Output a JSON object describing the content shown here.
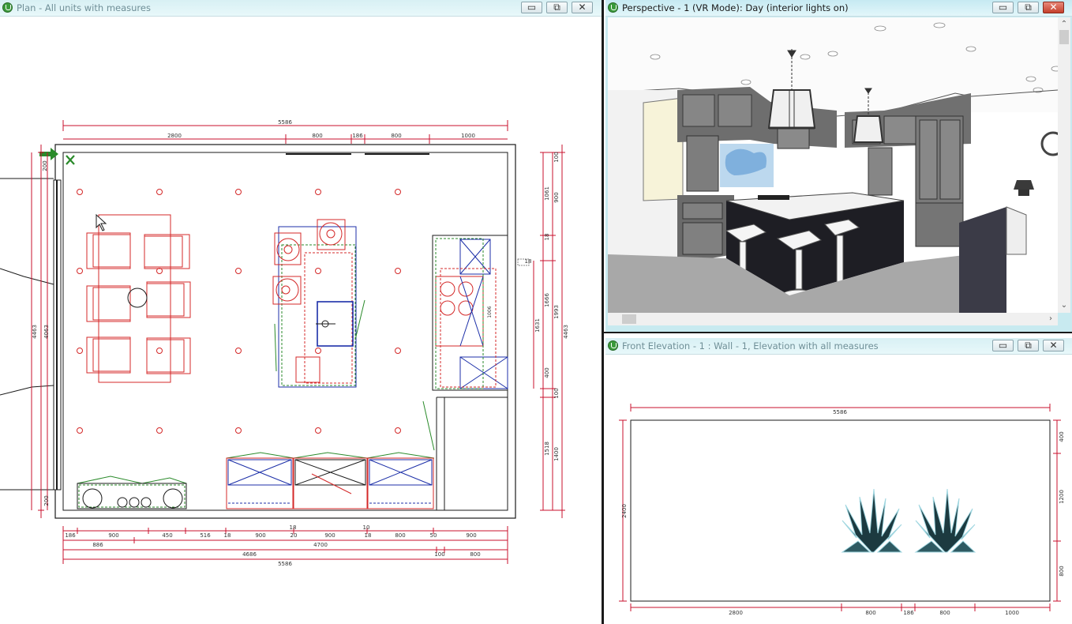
{
  "windows": {
    "plan": {
      "title": "Plan - All units with measures"
    },
    "perspective": {
      "title": "Perspective - 1 (VR Mode): Day (interior lights on)"
    },
    "elevation": {
      "title": "Front Elevation - 1 : Wall - 1, Elevation with all measures"
    }
  },
  "controls": {
    "minimize": "▭",
    "restore": "⧉",
    "close": "✕"
  },
  "plan_dims": {
    "top_total": "5586",
    "top_a": "2800",
    "top_b": "800",
    "top_c": "186",
    "top_d": "800",
    "top_e": "1000",
    "bottom_row1": [
      "186",
      "900",
      "450",
      "516",
      "18",
      "900",
      "20",
      "900",
      "18",
      "800",
      "50",
      "900"
    ],
    "bottom_extra_a": "18",
    "bottom_extra_b": "10",
    "bottom_row2_a": "886",
    "bottom_row2_b": "4700",
    "bottom_row3_a": "4686",
    "bottom_row3_b": "100",
    "bottom_row3_c": "800",
    "bottom_total": "5586",
    "left_a": "200",
    "left_b": "4063",
    "left_c": "4463",
    "left_d": "200",
    "right_a": "100",
    "right_b": "1061",
    "right_c": "900",
    "right_d": "18",
    "right_e": "18",
    "right_f": "1666",
    "right_g": "1631",
    "right_h": "1993",
    "right_i": "1006",
    "right_j": "400",
    "right_k": "100",
    "right_l": "1518",
    "right_m": "1400",
    "right_total": "4463"
  },
  "elev_dims": {
    "top_total": "5586",
    "left": "2400",
    "right_a": "400",
    "right_b": "1200",
    "right_c": "800",
    "bottom": [
      "2800",
      "800",
      "186",
      "800",
      "1000"
    ]
  },
  "colors": {
    "dim": "#c8102e",
    "furniture": "#d42828",
    "cabinet_blue": "#1c2fa8",
    "plant_green": "#2a8a2a",
    "titlebar": "#d8f0f4"
  }
}
